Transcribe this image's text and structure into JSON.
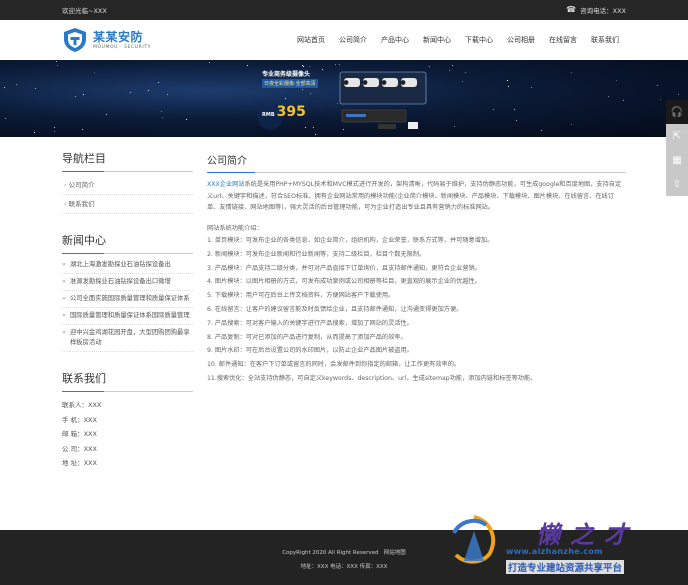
{
  "topbar": {
    "welcome": "欢迎光临~XXX",
    "phone_label": "咨询电话：XXX"
  },
  "logo": {
    "name_cn": "某某安防",
    "name_en": "MOUMOU · SECURITY"
  },
  "nav": [
    "网站首页",
    "公司简介",
    "产品中心",
    "新闻中心",
    "下载中心",
    "公司相册",
    "在线留言",
    "联系我们"
  ],
  "banner": {
    "promo_title": "专业商务级摄像头",
    "promo_sub": "日夜全彩摄像·全部高清",
    "price_prefix": "RMB",
    "price": "395"
  },
  "sidebar": {
    "nav_title": "导航栏目",
    "categories": [
      "公司简介",
      "联系我们"
    ],
    "news_title": "新闻中心",
    "news": [
      "湖北上海激发勘探业石油钻探设备出",
      "准源发勘探业石油钻探设备出口微增",
      "公司全面实施国际质量管理和质量保证体系",
      "国际质量管理和质量保证体系国际质量管理",
      "迎中兴金鸡湖花园开盘，大型团购团购最享样板房活动"
    ],
    "contact_title": "联系我们",
    "contact": [
      "联系人：XXX",
      "手 机：XXX",
      "邮 箱：XXX",
      "公 司：XXX",
      "地 址：XXX"
    ]
  },
  "main": {
    "title": "公司简介",
    "intro_highlight": "XXX企业网站",
    "intro": "系统是采用PHP+MYSQL技术和MVC模式进行开发的，架构清晰，代码易于维护，支持伪静态功能，可生成google和百度地图，支持自定义url、关键字和描述，符合SEO标准。拥有企业网站常用的模块功能(企业简介模块、新闻模块、产品模块、下载模块、图片模块、在线留言、在线订单、友情链接、网站地图等)，强大灵活的后台管理功能，可为企业打造出专业且具有营销力的标准网站。",
    "features_title": "网站系统功能介绍：",
    "features": [
      "1. 单页模块：可发布企业的各类信息，如企业简介，组织机构，企业荣誉，联系方式等，并可随意增加。",
      "2. 新闻模块：可发布企业新闻和行业新闻等，支持二级栏目，栏目个数无限制。",
      "3. 产品模块：产品支持二级分类，并可对产品直接下订单询价，且支持邮件通知，更符合企业营销。",
      "4. 图片模块：以图片相册的方式，可发布成功案例或公司相册等栏目，更直观的展示企业的优越性。",
      "5. 下载模块：用户可在后台上传文档资料，方便网站客户下载使用。",
      "6. 在线留言：让客户的建议留言能及时反馈给企业，且支持邮件通知，让沟通变得更加方便。",
      "7. 产品搜索：可对客户输入的关键字进行产品搜索，增加了网站的灵活性。",
      "8. 产品复制：可对已添加的产品进行复制，从而提高了添加产品的效率。",
      "9. 图片水印：可在后台设置公司的水印图片，以防止企业产品图片被盗用。",
      "10. 邮件通知：在客户下订单或留言的同时，会发邮件到你指定的邮箱，让工作更有效率的。",
      "11.搜索优化：全站支持伪静态，可自定义keywords、description、url，生成sitemap功能，添加内链和标签等功能。"
    ]
  },
  "footer": {
    "copyright": "CopyRight 2020 All Right Reserved",
    "sitemap": "网站地图",
    "contact_line": "地址：XXX  电话：XXX  传真：XXX"
  },
  "watermark": {
    "name": "懒之才",
    "url": "www.aizhanzhe.com",
    "slogan": "打造专业建站资源共享平台"
  },
  "colors": {
    "accent": "#2b7ac7",
    "topbar": "#262626",
    "footer": "#232323"
  }
}
